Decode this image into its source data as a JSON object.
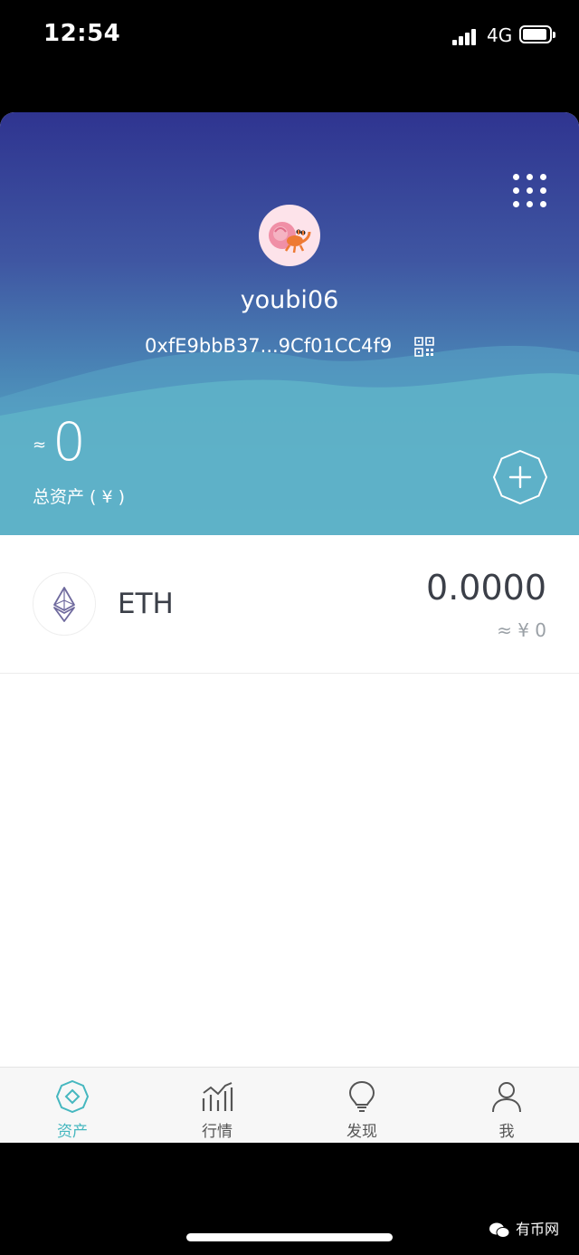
{
  "status_bar": {
    "time": "12:54",
    "network": "4G"
  },
  "header": {
    "wallet_name": "youbi06",
    "address": "0xfE9bbB37...9Cf01CC4f9",
    "approx_symbol": "≈",
    "total_value": "0",
    "total_label": "总资产 ( ¥ )"
  },
  "tokens": [
    {
      "symbol": "ETH",
      "balance": "0.0000",
      "fiat_value": "≈ ¥ 0"
    }
  ],
  "tabbar": {
    "tabs": [
      {
        "label": "资产",
        "icon": "assets-icon",
        "active": true
      },
      {
        "label": "行情",
        "icon": "market-chart-icon",
        "active": false
      },
      {
        "label": "发现",
        "icon": "lightbulb-icon",
        "active": false
      },
      {
        "label": "我",
        "icon": "person-icon",
        "active": false
      }
    ]
  },
  "watermark": {
    "text": "有币网"
  },
  "colors": {
    "accent": "#45b7bf",
    "header_top": "#2f3490",
    "header_bottom": "#5fb4c8",
    "text_dark": "#3b3f48"
  }
}
